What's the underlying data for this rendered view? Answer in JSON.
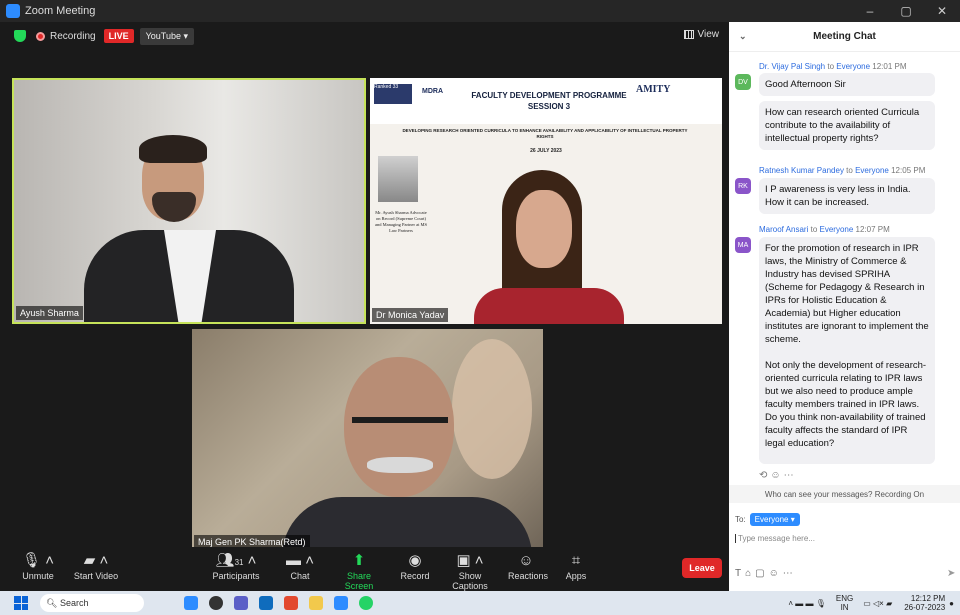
{
  "window": {
    "title": "Zoom Meeting",
    "controls": [
      "–",
      "▢",
      "✕"
    ]
  },
  "status": {
    "recording": "Recording",
    "live": "LIVE",
    "stream": "YouTube ▾",
    "view": "View"
  },
  "tiles": [
    {
      "name": "Ayush Sharma"
    },
    {
      "name": "Dr Monica Yadav"
    },
    {
      "name": "Maj Gen PK Sharma(Retd)"
    }
  ],
  "slide": {
    "title": "FACULTY DEVELOPMENT PROGRAMME SESSION 3",
    "subtitle": "DEVELOPING RESEARCH ORIENTED CURRICULA TO ENHANCE AVAILABILITY AND APPLICABILITY OF INTELLECTUAL PROPERTY RIGHTS",
    "date": "26 JULY 2023",
    "logo_left": "Ranked 33",
    "logo_mid": "MDRA",
    "logo_right": "AMITY",
    "speaker": "Mr. Ayush Sharma Advocate on Record (Supreme Court) and Managing Partner at MS Law Partners"
  },
  "toolbar": {
    "unmute": "Unmute",
    "start_video": "Start Video",
    "participants": "Participants",
    "participants_count": "31",
    "chat": "Chat",
    "share_screen": "Share Screen",
    "record": "Record",
    "show_captions": "Show Captions",
    "reactions": "Reactions",
    "apps": "Apps",
    "leave": "Leave"
  },
  "chat": {
    "title": "Meeting Chat",
    "messages": [
      {
        "initials": "DV",
        "sender": "Dr. Vijay Pal Singh",
        "to": "to",
        "recipient": "Everyone",
        "time": "12:01 PM",
        "texts": [
          "Good Afternoon Sir",
          "How can research oriented Curricula contribute to the availability of intellectual property rights?"
        ]
      },
      {
        "initials": "RK",
        "sender": "Ratnesh Kumar Pandey",
        "to": "to",
        "recipient": "Everyone",
        "time": "12:05 PM",
        "texts": [
          "I P awareness is very less in India. How it can be increased."
        ]
      },
      {
        "initials": "MA",
        "sender": "Maroof Ansari",
        "to": "to",
        "recipient": "Everyone",
        "time": "12:07 PM",
        "texts": [
          "For the promotion of research in IPR laws, the Ministry of Commerce & Industry has devised SPRIHA (Scheme for Pedagogy & Research in IPRs for Holistic Education & Academia) but Higher education institutes are ignorant to implement the scheme.\n\nNot only the development of research-oriented curricula relating to IPR laws but we also need to produce ample faculty members trained in IPR laws. Do you think non-availability of trained faculty affects the standard of IPR legal education?"
        ]
      }
    ],
    "who_can_see": "Who can see your messages? Recording On",
    "to_label": "To:",
    "to_value": "Everyone ▾",
    "placeholder": "Type message here..."
  },
  "taskbar": {
    "search": "Search",
    "lang": "ENG",
    "region": "IN",
    "time": "12:12 PM",
    "date": "26-07-2023"
  },
  "colors": {
    "accent": "#2d8cff",
    "leave": "#e02828",
    "speaking_border": "#c6e35a",
    "share_green": "#23d959"
  }
}
